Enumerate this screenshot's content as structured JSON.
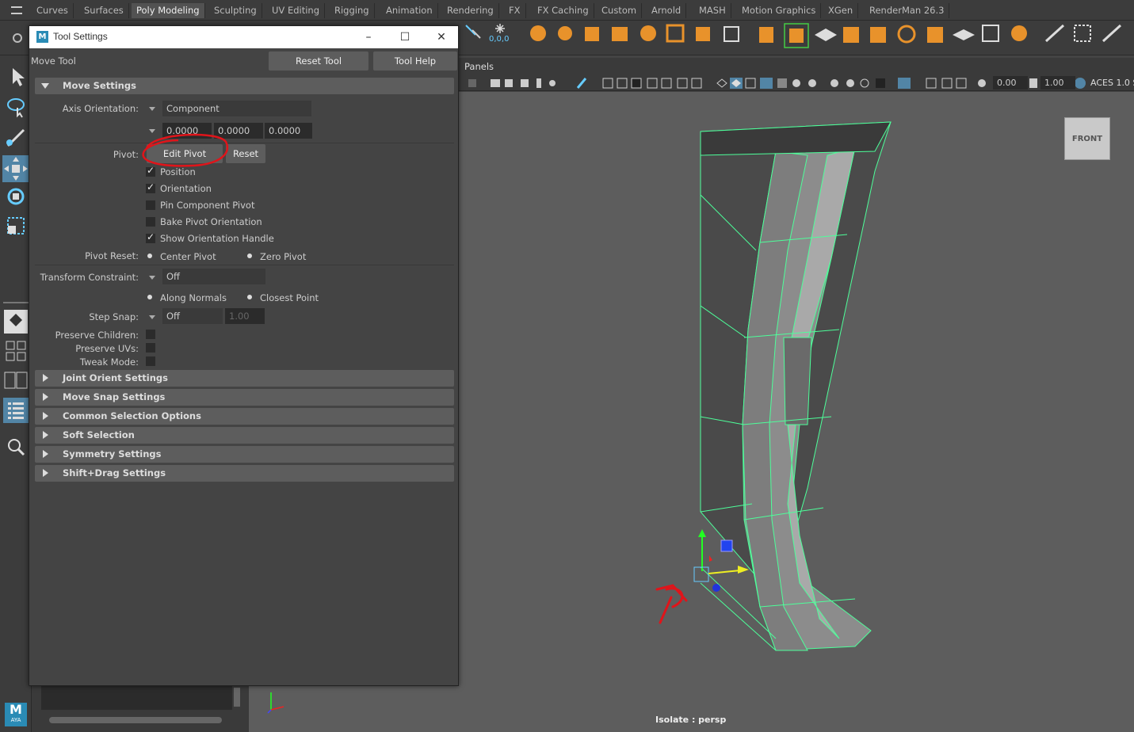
{
  "shelf_tabs": [
    "Curves",
    "Surfaces",
    "Poly Modeling",
    "Sculpting",
    "UV Editing",
    "Rigging",
    "Animation",
    "Rendering",
    "FX",
    "FX Caching",
    "Custom",
    "Arnold",
    "MASH",
    "Motion Graphics",
    "XGen",
    "RenderMan 26.3"
  ],
  "active_tab": "Poly Modeling",
  "shelf": {
    "origin_readout": "0,0,0"
  },
  "viewport": {
    "panels_menu": "Panels",
    "field_a": "0.00",
    "field_b": "1.00",
    "color_space": "ACES 1.0 S",
    "view_cube_label": "FRONT",
    "status": "Isolate : persp"
  },
  "tool_settings": {
    "window_title": "Tool Settings",
    "logo_letter": "M",
    "tool_name": "Move Tool",
    "reset_tool_label": "Reset Tool",
    "tool_help_label": "Tool Help",
    "move_settings": {
      "title": "Move Settings",
      "axis_orientation_label": "Axis Orientation:",
      "axis_orientation_value": "Component",
      "xyz": [
        "0.0000",
        "0.0000",
        "0.0000"
      ],
      "pivot_label": "Pivot:",
      "edit_pivot_label": "Edit Pivot",
      "reset_label": "Reset",
      "checkboxes": [
        {
          "label": "Position",
          "checked": true
        },
        {
          "label": "Orientation",
          "checked": true
        },
        {
          "label": "Pin Component Pivot",
          "checked": false
        },
        {
          "label": "Bake Pivot Orientation",
          "checked": false
        },
        {
          "label": "Show Orientation Handle",
          "checked": true
        }
      ],
      "pivot_reset_label": "Pivot Reset:",
      "center_pivot_label": "Center Pivot",
      "zero_pivot_label": "Zero Pivot",
      "transform_constraint_label": "Transform Constraint:",
      "transform_constraint_value": "Off",
      "along_normals_label": "Along Normals",
      "closest_point_label": "Closest Point",
      "step_snap_label": "Step Snap:",
      "step_snap_value": "Off",
      "step_snap_amount": "1.00",
      "preserve_children_label": "Preserve Children:",
      "preserve_uvs_label": "Preserve UVs:",
      "tweak_mode_label": "Tweak Mode:"
    },
    "collapsed_sections": [
      "Joint Orient Settings",
      "Move Snap Settings",
      "Common Selection Options",
      "Soft Selection",
      "Symmetry Settings",
      "Shift+Drag Settings"
    ]
  },
  "bottom_logo": "M",
  "bottom_logo_sub": "AYA",
  "colors": {
    "accent": "#5285a6",
    "mesh_wire": "#4dff9a",
    "annotation_red": "#e0141a"
  }
}
